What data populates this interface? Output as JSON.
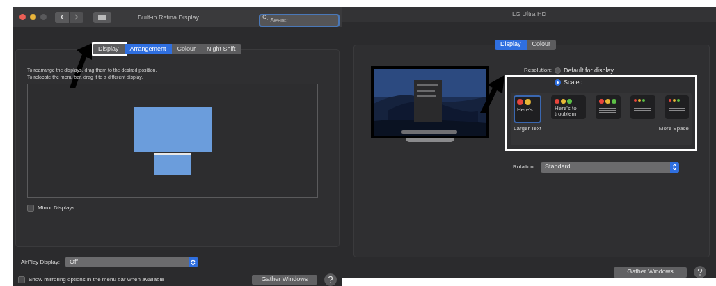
{
  "left_window": {
    "title": "Built-in Retina Display",
    "search": {
      "placeholder": "Search"
    },
    "tabs": [
      {
        "label": "Display",
        "selected": false,
        "highlighted": true
      },
      {
        "label": "Arrangement",
        "selected": true,
        "highlighted": false
      },
      {
        "label": "Colour",
        "selected": false,
        "highlighted": false
      },
      {
        "label": "Night Shift",
        "selected": false,
        "highlighted": false
      }
    ],
    "instructions": [
      "To rearrange the displays, drag them to the desired position.",
      "To relocate the menu bar, drag it to a different display."
    ],
    "mirror_displays": {
      "label": "Mirror Displays",
      "checked": false
    },
    "airplay": {
      "label": "AirPlay Display:",
      "value": "Off"
    },
    "show_mirroring": {
      "label": "Show mirroring options in the menu bar when available",
      "checked": false
    },
    "gather_button": "Gather Windows"
  },
  "right_window": {
    "title": "LG Ultra HD",
    "tabs": [
      {
        "label": "Display",
        "selected": true
      },
      {
        "label": "Colour",
        "selected": false
      }
    ],
    "resolution_label": "Resolution:",
    "resolution_options": [
      {
        "label": "Default for display",
        "selected": false
      },
      {
        "label": "Scaled",
        "selected": true
      }
    ],
    "scale_options": [
      {
        "text": "Here's",
        "selected": true
      },
      {
        "text": "Here's to troublem",
        "selected": false
      },
      {
        "selected": false
      },
      {
        "selected": false
      },
      {
        "selected": false
      }
    ],
    "scale_min_label": "Larger Text",
    "scale_max_label": "More Space",
    "rotation": {
      "label": "Rotation:",
      "value": "Standard"
    },
    "gather_button": "Gather Windows"
  }
}
